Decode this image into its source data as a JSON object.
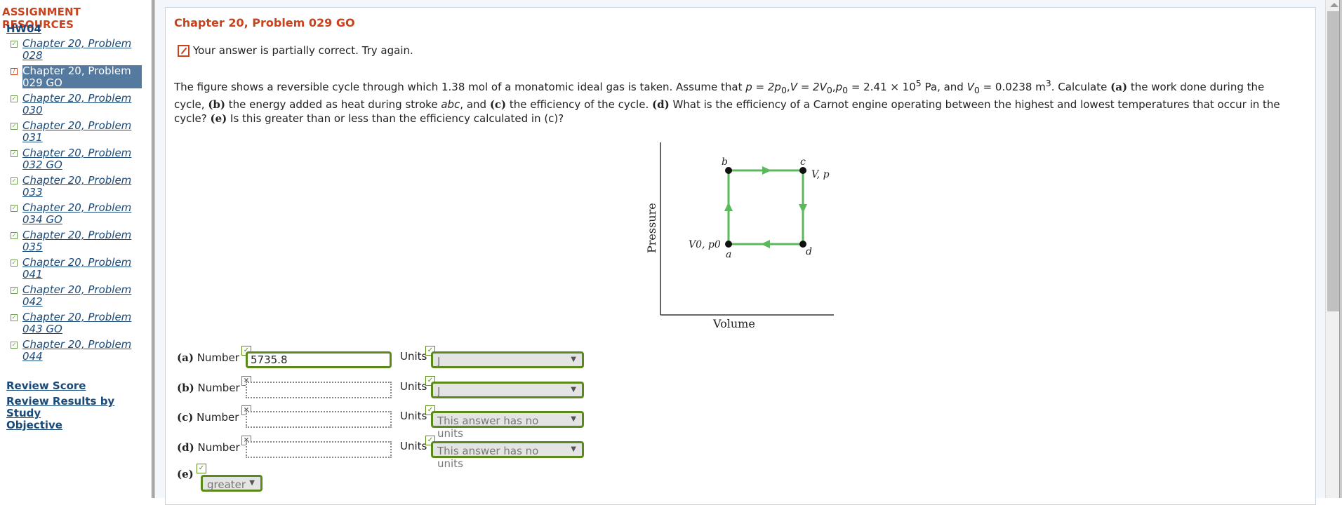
{
  "sidebar": {
    "title": "ASSIGNMENT RESOURCES",
    "assignment": "HW04",
    "problems": [
      {
        "line1": "Chapter 20, Problem",
        "line2": "028",
        "status": "correct"
      },
      {
        "line1": "Chapter 20, Problem",
        "line2": "029 GO",
        "status": "partial",
        "current": true
      },
      {
        "line1": "Chapter 20, Problem",
        "line2": "030",
        "status": "correct"
      },
      {
        "line1": "Chapter 20, Problem",
        "line2": "031",
        "status": "correct"
      },
      {
        "line1": "Chapter 20, Problem",
        "line2": "032 GO",
        "status": "correct"
      },
      {
        "line1": "Chapter 20, Problem",
        "line2": "033",
        "status": "correct"
      },
      {
        "line1": "Chapter 20, Problem",
        "line2": "034 GO",
        "status": "correct"
      },
      {
        "line1": "Chapter 20, Problem",
        "line2": "035",
        "status": "correct"
      },
      {
        "line1": "Chapter 20, Problem",
        "line2": "041",
        "status": "correct"
      },
      {
        "line1": "Chapter 20, Problem",
        "line2": "042",
        "status": "correct"
      },
      {
        "line1": "Chapter 20, Problem",
        "line2": "043 GO",
        "status": "correct"
      },
      {
        "line1": "Chapter 20, Problem",
        "line2": "044",
        "status": "correct"
      }
    ],
    "review_score": "Review Score",
    "review_results_line1": "Review Results by Study",
    "review_results_line2": "Objective"
  },
  "question": {
    "title": "Chapter 20, Problem 029 GO",
    "feedback": "Your answer is partially correct.  Try again.",
    "text_part1": "The figure shows a reversible cycle through which 1.38 mol of a monatomic ideal gas is taken. Assume that ",
    "p_eq": "p = 2p",
    "v_eq": "V = 2V",
    "p0_eq": "p",
    "p0_value": " = 2.41 × 10",
    "p0_exp": "5",
    "p0_unit": " Pa, and ",
    "v0": "V",
    "v0_value": " = 0.0238 m",
    "v0_exp": "3",
    "text_calc": ". Calculate ",
    "a": "(a)",
    "a_text": " the work done during the cycle, ",
    "b": "(b)",
    "b_text": " the energy added as heat during stroke ",
    "abc": "abc",
    "b_text2": ", and ",
    "c": "(c)",
    "c_text": " the efficiency of the cycle. ",
    "d": "(d)",
    "d_text": " What is the efficiency of a Carnot engine operating between the highest and lowest temperatures that occur in the cycle? ",
    "e": "(e)",
    "e_text": " Is this greater than or less than the efficiency calculated in (c)?",
    "sub0": "0"
  },
  "figure": {
    "xlabel": "Volume",
    "ylabel": "Pressure",
    "points": {
      "a": "a",
      "b": "b",
      "c": "c",
      "d": "d"
    },
    "label_a": "V0, p0",
    "label_c": "V, p"
  },
  "answers": [
    {
      "part": "(a)",
      "number_label": "Number",
      "value": "5735.8",
      "number_status": "correct",
      "units_label": "Units",
      "units": "J",
      "units_status": "correct"
    },
    {
      "part": "(b)",
      "number_label": "Number",
      "value": "",
      "number_status": "incorrect",
      "units_label": "Units",
      "units": "J",
      "units_status": "correct"
    },
    {
      "part": "(c)",
      "number_label": "Number",
      "value": "",
      "number_status": "incorrect",
      "units_label": "Units",
      "units": "This answer has no units",
      "units_status": "correct"
    },
    {
      "part": "(d)",
      "number_label": "Number",
      "value": "",
      "number_status": "incorrect",
      "units_label": "Units",
      "units": "This answer has no units",
      "units_status": "correct"
    },
    {
      "part": "(e)",
      "selection": "greater",
      "status": "correct"
    }
  ],
  "colors": {
    "accent": "#c9421b",
    "link": "#1a4a7a",
    "correct": "#5a8a1a",
    "cycle": "#5cb85c"
  }
}
